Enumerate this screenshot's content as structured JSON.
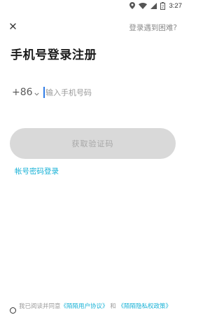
{
  "status_bar": {
    "time": "3:27",
    "battery": "2",
    "icons": [
      "location-icon",
      "wifi-icon",
      "signal-icon",
      "battery-icon"
    ]
  },
  "header": {
    "close_icon": "close-icon",
    "help_link": "登录遇到困难?"
  },
  "title": "手机号登录注册",
  "phone": {
    "country_code": "+86",
    "placeholder": "输入手机号码",
    "value": ""
  },
  "get_code_button": "获取验证码",
  "password_login_link": "帐号密码登录",
  "agreement": {
    "prefix": "我已阅读并同意",
    "user_agreement": "《陌陌用户协议》",
    "conjunction": "和",
    "privacy_policy": "《陌陌隐私权政策》",
    "checked": false
  },
  "colors": {
    "accent": "#16b1d6",
    "caret": "#2f7be6",
    "button_disabled_bg": "#d9d9d9",
    "button_disabled_text": "#a7a7a7"
  }
}
